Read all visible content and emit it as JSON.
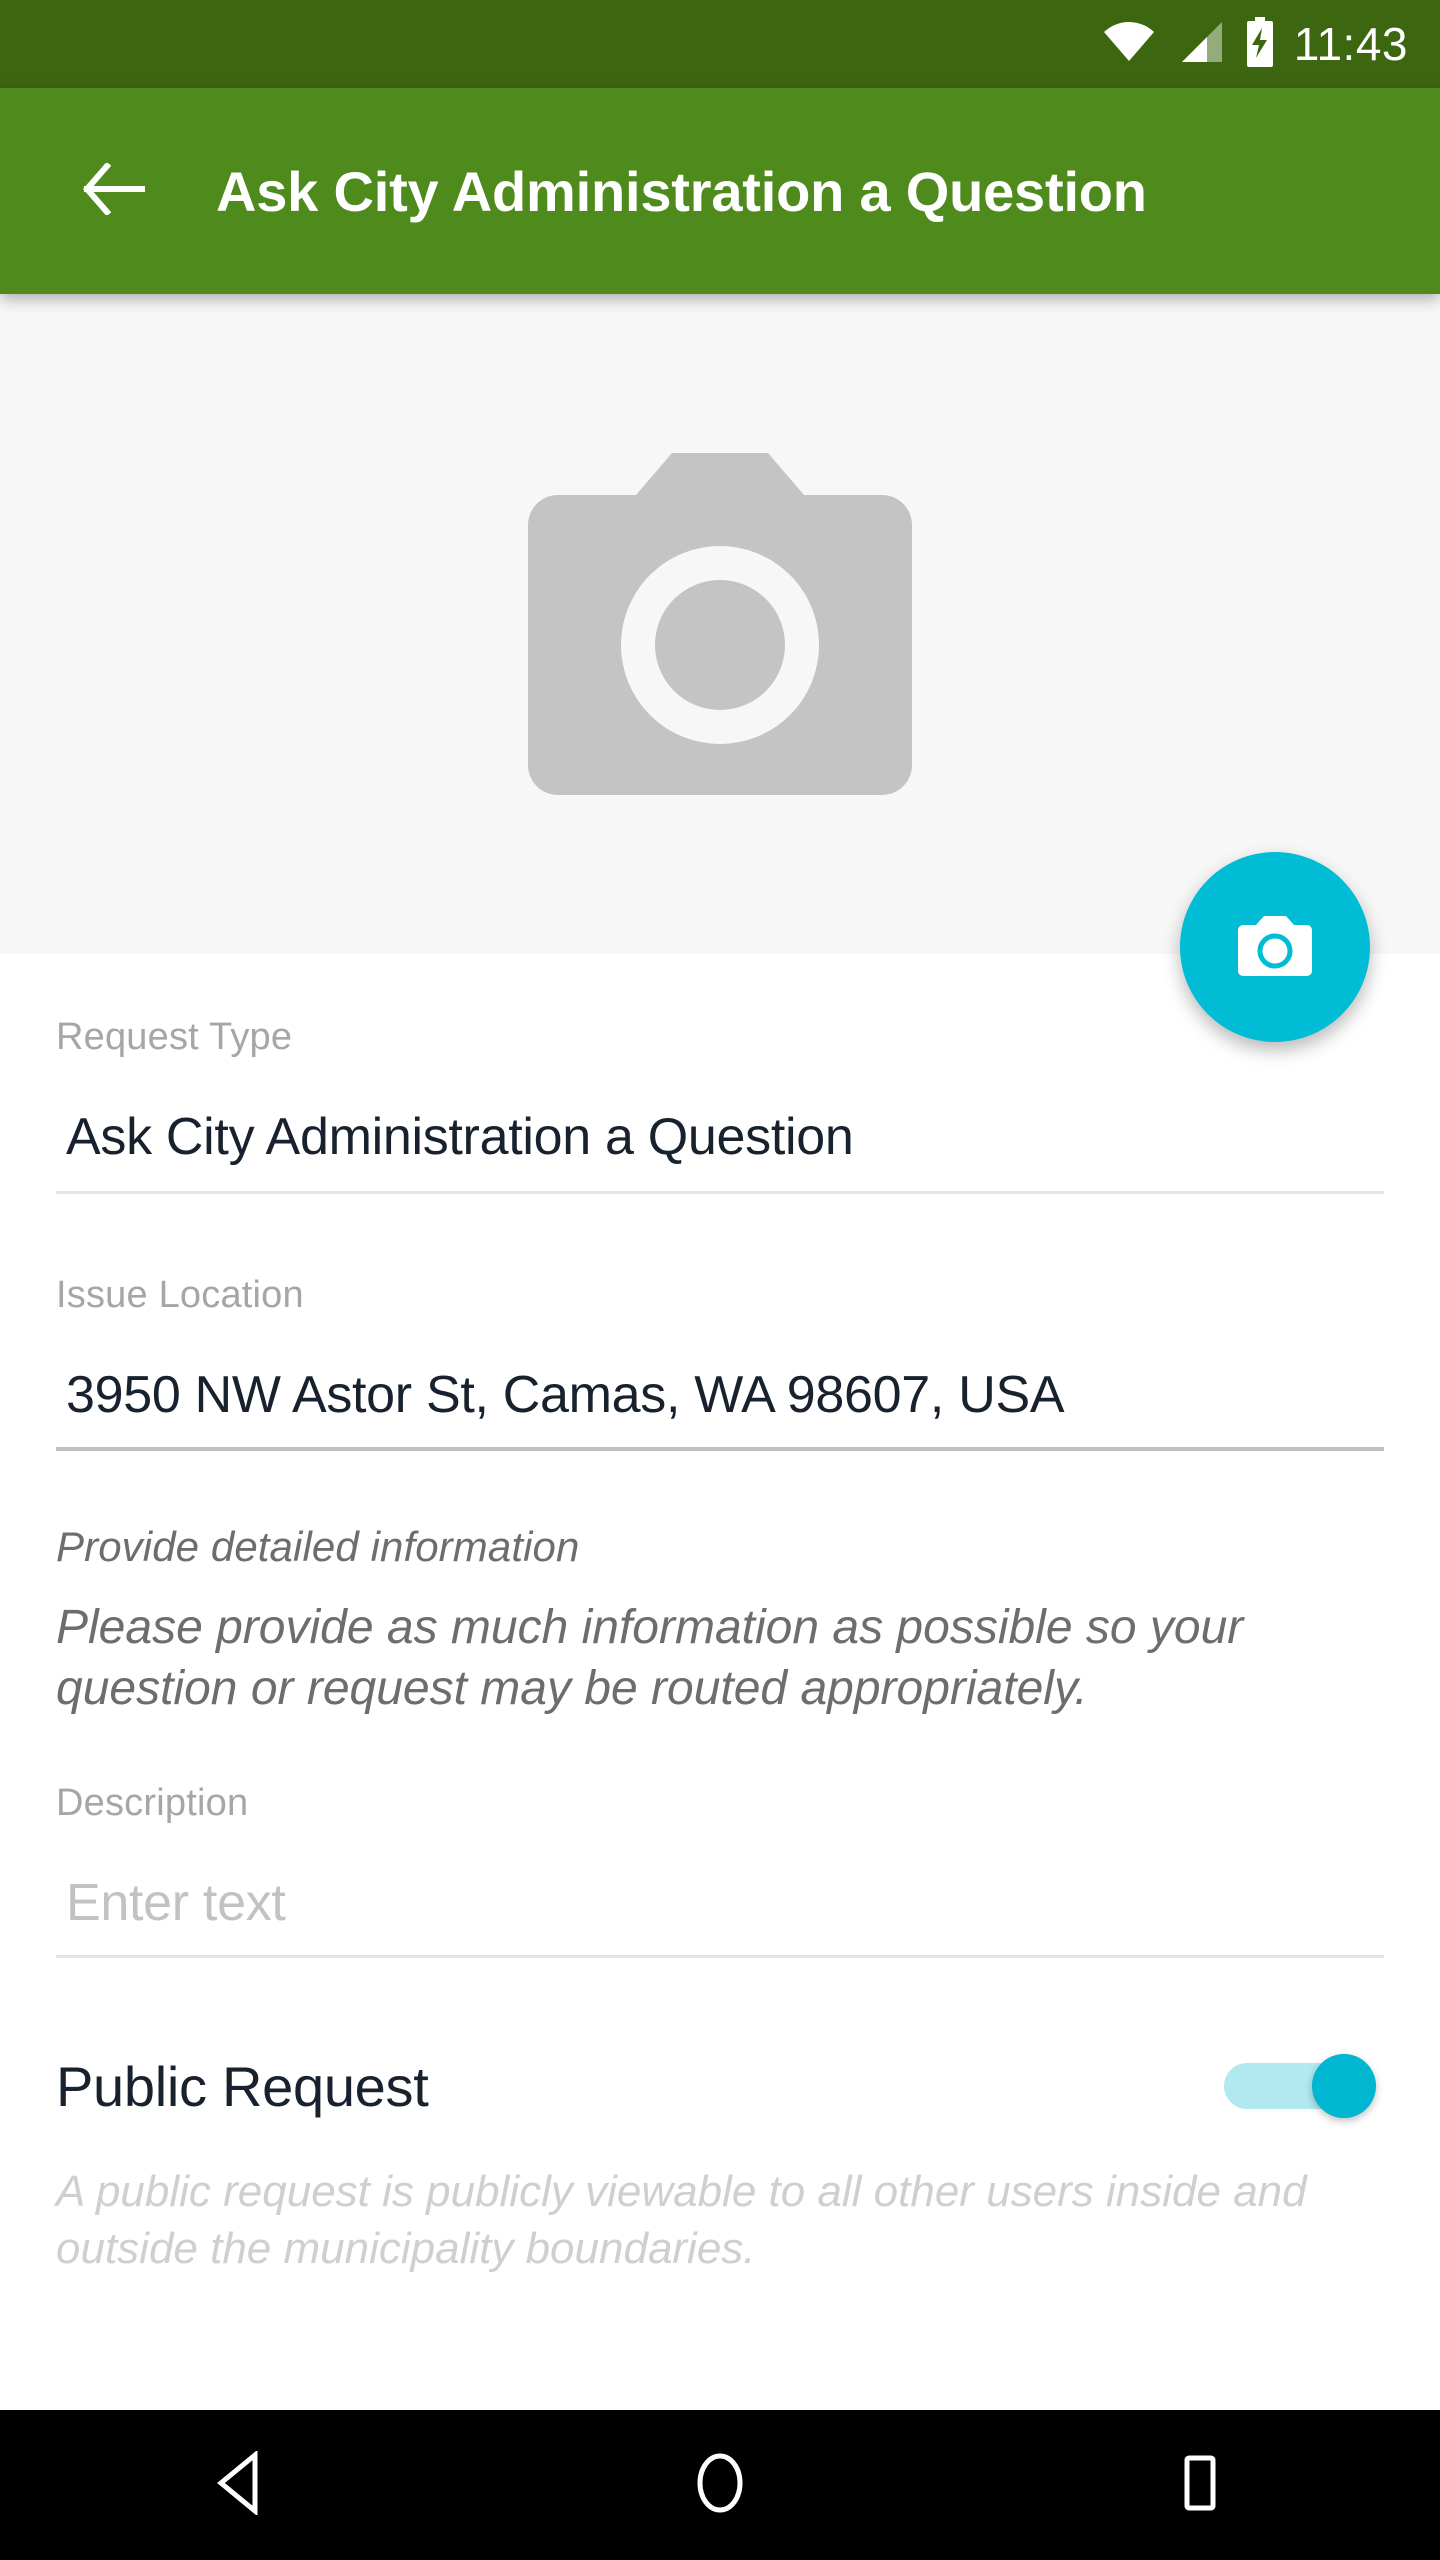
{
  "status_bar": {
    "time": "11:43",
    "icons": [
      "wifi-icon",
      "cellular-signal-icon",
      "battery-charging-icon"
    ],
    "background_color": "#3d6610"
  },
  "app_bar": {
    "title": "Ask City Administration a Question",
    "back_icon": "arrow-left-icon",
    "background_color": "#4e8a1c",
    "text_color": "#ffffff"
  },
  "photo_area": {
    "placeholder_icon": "camera-placeholder-icon",
    "background_color": "#f7f7f7",
    "placeholder_color": "#c4c4c4",
    "fab": {
      "icon": "camera-icon",
      "color": "#00bcd4"
    }
  },
  "form": {
    "request_type": {
      "label": "Request Type",
      "value": "Ask City Administration a Question"
    },
    "issue_location": {
      "label": "Issue Location",
      "value": "3950 NW Astor St, Camas, WA 98607, USA"
    },
    "detail_info": {
      "title": "Provide detailed information",
      "body": "Please provide as much information as possible so your question or request may be routed appropriately."
    },
    "description": {
      "label": "Description",
      "value": "",
      "placeholder": "Enter text"
    },
    "public_request": {
      "label": "Public Request",
      "state": "on",
      "help": "A public request is publicly viewable to all other users inside and outside the municipality boundaries.",
      "accent_color": "#00b6d0",
      "track_color": "#b2e8ef"
    }
  },
  "nav_bar": {
    "background_color": "#000000",
    "buttons": [
      {
        "name": "back",
        "icon": "triangle-back-icon"
      },
      {
        "name": "home",
        "icon": "circle-home-icon"
      },
      {
        "name": "recents",
        "icon": "square-recents-icon"
      }
    ]
  }
}
